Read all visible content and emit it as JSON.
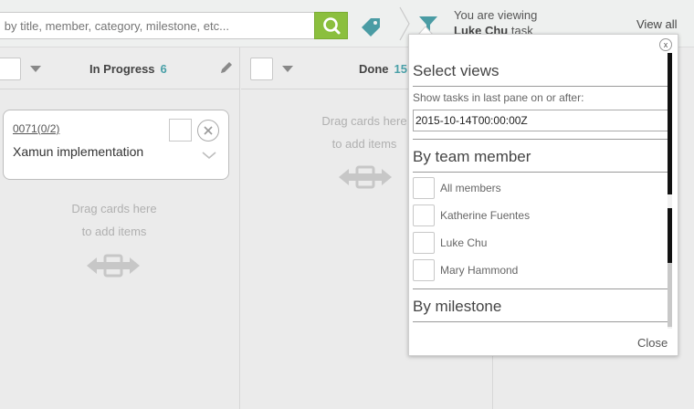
{
  "search": {
    "placeholder": "Search by title, member, category, milestone, etc..."
  },
  "viewing": {
    "line1": "You are viewing",
    "user": "Luke Chu",
    "suffix": " task"
  },
  "header": {
    "view_all": "View all"
  },
  "columns": [
    {
      "title": "In Progress",
      "count": "6"
    },
    {
      "title": "Done",
      "count": "15"
    }
  ],
  "card": {
    "id": "0071(0/2)",
    "title": "Xamun implementation"
  },
  "drag_hint": {
    "line1": "Drag cards here",
    "line2": "to add items"
  },
  "popup": {
    "close_x": "x",
    "title": "Select views",
    "show_label": "Show tasks in last pane on or after:",
    "date_value": "2015-10-14T00:00:00Z",
    "team_title": "By team member",
    "members": [
      "All members",
      "Katherine Fuentes",
      "Luke Chu",
      "Mary Hammond"
    ],
    "milestone_title": "By milestone",
    "close_label": "Close"
  },
  "colors": {
    "accent_green": "#8bbf3e",
    "teal": "#4aa0a8"
  },
  "icons": [
    "search-icon",
    "tag-icon",
    "filter-icon",
    "pencil-icon",
    "close-icon",
    "chevron-down-icon",
    "drag-arrows-icon"
  ]
}
